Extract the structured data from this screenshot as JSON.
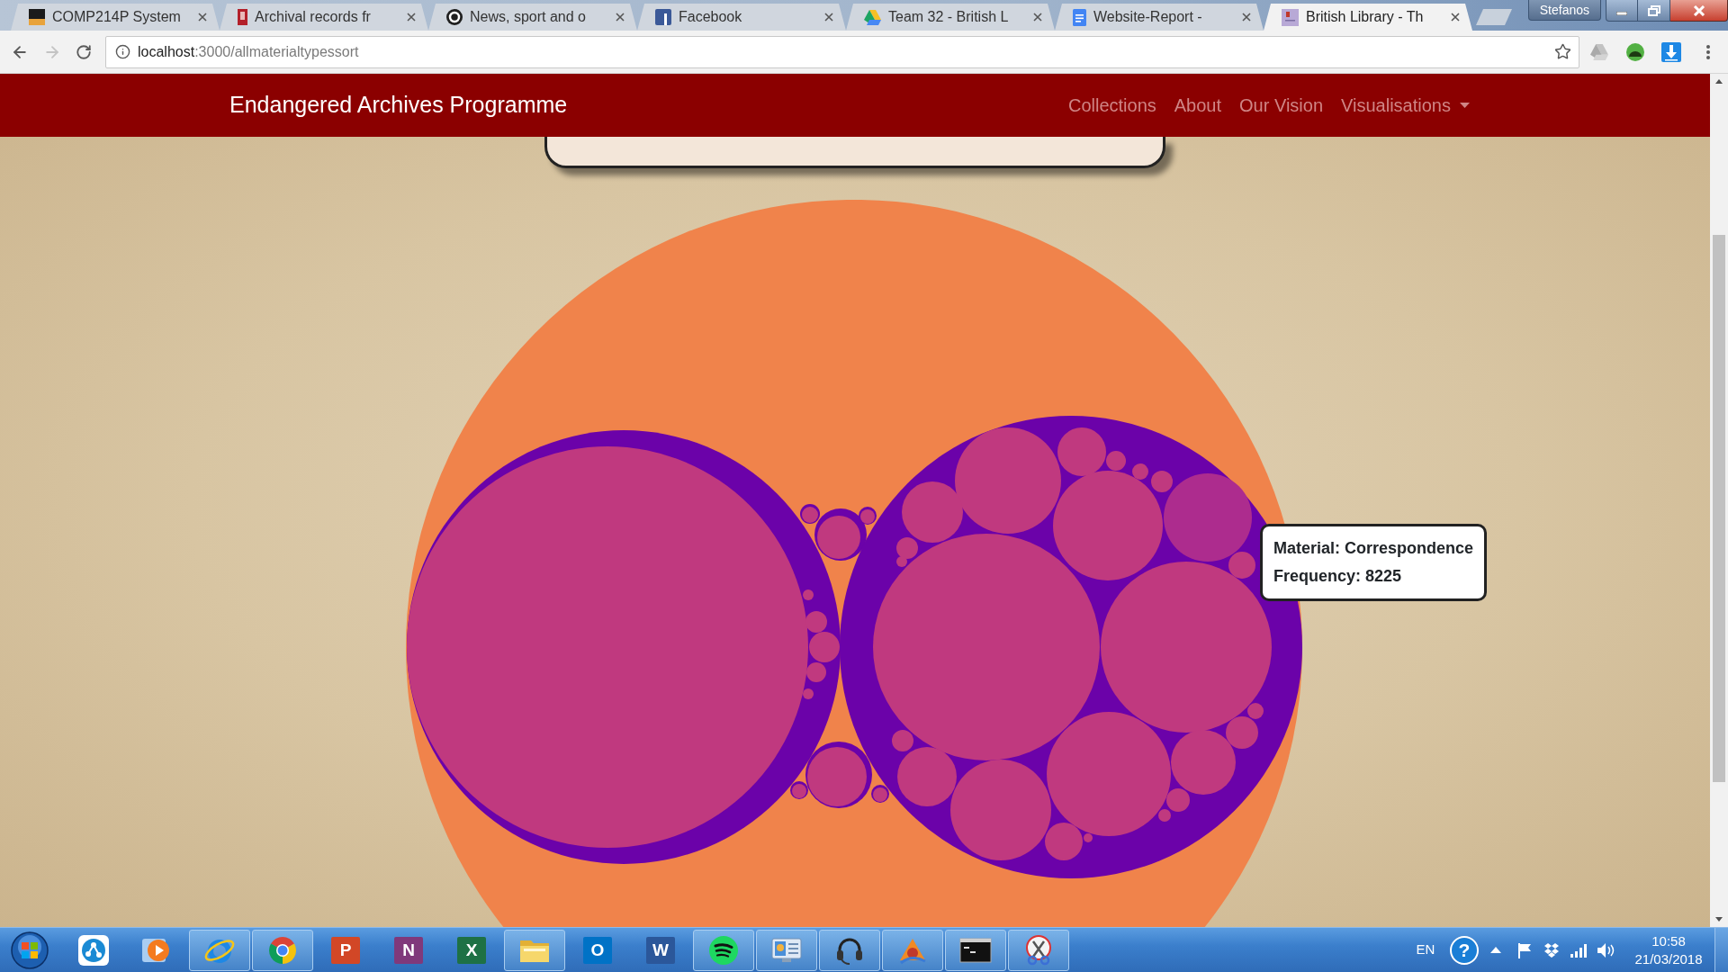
{
  "browser": {
    "tabs": [
      {
        "title": "COMP214P System",
        "kind": "tile",
        "selected": false
      },
      {
        "title": "Archival records fr",
        "kind": "book",
        "selected": false
      },
      {
        "title": "News, sport and o",
        "kind": "circle",
        "selected": false
      },
      {
        "title": "Facebook",
        "kind": "square",
        "selected": false
      },
      {
        "title": "Team 32 - British L",
        "kind": "triangle",
        "selected": false
      },
      {
        "title": "Website-Report -",
        "kind": "document",
        "selected": false
      },
      {
        "title": "British Library - Th",
        "kind": "thumbnail",
        "selected": true
      }
    ],
    "profile": "Stefanos",
    "nav_buttons": [
      {
        "kind": "back",
        "disabled": false
      },
      {
        "kind": "forward",
        "disabled": true
      }
    ],
    "address": {
      "host": "localhost",
      "path": ":3000/allmaterialtypessort"
    }
  },
  "navbar": {
    "brand": "Endangered Archives Programme",
    "links": [
      {
        "label": "Collections",
        "dropdown": false
      },
      {
        "label": "About",
        "dropdown": false
      },
      {
        "label": "Our Vision",
        "dropdown": false
      },
      {
        "label": "Visualisations",
        "dropdown": true
      }
    ]
  },
  "tooltip": {
    "lines": [
      "Material: Correspondence",
      "Frequency: 8225"
    ]
  },
  "taskbar": {
    "apps": [
      {
        "kind": "share",
        "running": false
      },
      {
        "kind": "play",
        "running": false
      },
      {
        "kind": "orbit",
        "running": true
      },
      {
        "kind": "tricolor",
        "running": true
      },
      {
        "kind": "letter",
        "letter": "P",
        "color": "#d24726",
        "running": false
      },
      {
        "kind": "letter",
        "letter": "N",
        "color": "#80397b",
        "running": false
      },
      {
        "kind": "letter",
        "letter": "X",
        "color": "#1e7145",
        "running": false
      },
      {
        "kind": "folder",
        "running": true
      },
      {
        "kind": "letter",
        "letter": "O",
        "color": "#0072c6",
        "running": false
      },
      {
        "kind": "letter",
        "letter": "W",
        "color": "#2b579a",
        "running": false
      },
      {
        "kind": "waves",
        "running": true
      },
      {
        "kind": "monitor",
        "running": true
      },
      {
        "kind": "headset",
        "running": true
      },
      {
        "kind": "fan",
        "running": true
      },
      {
        "kind": "terminal",
        "running": true
      },
      {
        "kind": "scissors",
        "running": true
      }
    ],
    "tray": {
      "language": "EN",
      "help": "?",
      "time": "10:58",
      "date": "21/03/2018"
    }
  }
}
